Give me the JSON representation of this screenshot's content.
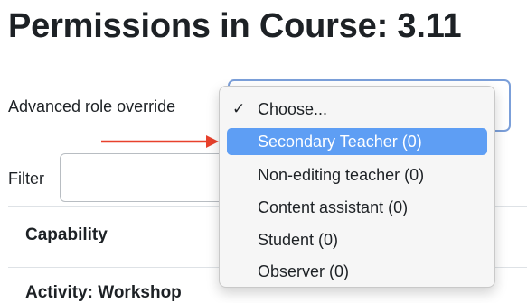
{
  "page": {
    "title": "Permissions in Course: 3.11"
  },
  "override": {
    "label": "Advanced role override",
    "selected": "Choose...",
    "options": [
      "Choose...",
      "Secondary Teacher (0)",
      "Non-editing teacher (0)",
      "Content assistant (0)",
      "Student (0)",
      "Observer (0)"
    ],
    "highlighted_option": "Secondary Teacher (0)"
  },
  "filter": {
    "label": "Filter",
    "value": ""
  },
  "table": {
    "header": "Capability",
    "first_row": "Activity: Workshop"
  },
  "icons": {
    "check": "checkmark-icon",
    "arrow": "red-arrow-right"
  },
  "colors": {
    "highlight": "#5e9ef4",
    "arrow": "#e8412c",
    "focus_border": "#7b9fd9"
  }
}
